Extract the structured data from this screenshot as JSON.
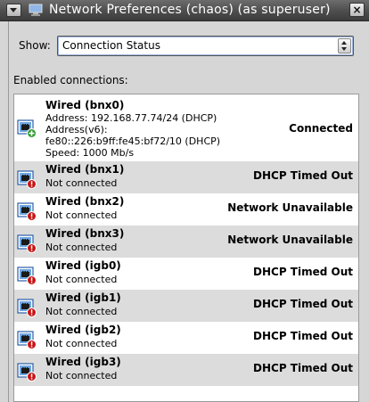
{
  "window": {
    "title": "Network Preferences (chaos) (as superuser)",
    "close_glyph": "×"
  },
  "show": {
    "label": "Show:",
    "selected": "Connection Status"
  },
  "enabled_label": "Enabled connections:",
  "connections": [
    {
      "name": "Wired (bnx0)",
      "details": [
        "Address: 192.168.77.74/24 (DHCP)",
        "Address(v6):",
        "fe80::226:b9ff:fe45:bf72/10 (DHCP)",
        "Speed: 1000 Mb/s"
      ],
      "status": "Connected",
      "state": "connected"
    },
    {
      "name": "Wired (bnx1)",
      "details": [
        "Not connected"
      ],
      "status": "DHCP Timed Out",
      "state": "error"
    },
    {
      "name": "Wired (bnx2)",
      "details": [
        "Not connected"
      ],
      "status": "Network Unavailable",
      "state": "error"
    },
    {
      "name": "Wired (bnx3)",
      "details": [
        "Not connected"
      ],
      "status": "Network Unavailable",
      "state": "error"
    },
    {
      "name": "Wired (igb0)",
      "details": [
        "Not connected"
      ],
      "status": "DHCP Timed Out",
      "state": "error"
    },
    {
      "name": "Wired (igb1)",
      "details": [
        "Not connected"
      ],
      "status": "DHCP Timed Out",
      "state": "error"
    },
    {
      "name": "Wired (igb2)",
      "details": [
        "Not connected"
      ],
      "status": "DHCP Timed Out",
      "state": "error"
    },
    {
      "name": "Wired (igb3)",
      "details": [
        "Not connected"
      ],
      "status": "DHCP Timed Out",
      "state": "error"
    }
  ],
  "icons": {
    "window_menu": "chevron-down-icon",
    "app": "network-icon",
    "close": "close-icon",
    "device": "network-card-icon",
    "badge_connected": "plus-badge-icon",
    "badge_error": "error-badge-icon"
  },
  "colors": {
    "titlebar": "#4d4d4d",
    "connected_badge": "#2f9a2f",
    "error_badge": "#c81414",
    "row_alt": "#dcdcdc"
  }
}
